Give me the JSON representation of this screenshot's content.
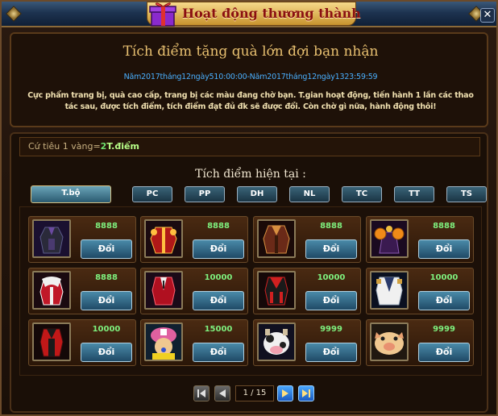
{
  "window": {
    "title": "Hoạt động thương thành",
    "close_label": "✕"
  },
  "banner": {
    "headline": "Tích điểm tặng quà lớn đợi bạn nhận",
    "date_range": "Năm2017tháng12ngày510:00:00-Năm2017tháng12ngày1323:59:59",
    "description": "Cực phẩm trang bị, quà cao cấp, trang bị các màu đang chờ bạn. T.gian hoạt động, tiến hành 1 lần các thao tác sau, được tích điểm, tích điểm đạt đủ đk sẽ được đổi. Còn chờ gì nữa, hành động thôi!"
  },
  "rate": {
    "prefix": "Cứ tiêu 1 vàng=",
    "value": "2",
    "unit": "T.điểm"
  },
  "points_label": "Tích điểm hiện tại :",
  "tabs": [
    {
      "label": "T.bộ",
      "active": true
    },
    {
      "label": "PC",
      "active": false
    },
    {
      "label": "PP",
      "active": false
    },
    {
      "label": "DH",
      "active": false
    },
    {
      "label": "NL",
      "active": false
    },
    {
      "label": "TC",
      "active": false
    },
    {
      "label": "TT",
      "active": false
    },
    {
      "label": "TS",
      "active": false
    }
  ],
  "items": [
    {
      "icon": "dark-armor-icon",
      "price": "8888",
      "button": "Đổi"
    },
    {
      "icon": "red-gold-coat-icon",
      "price": "8888",
      "button": "Đổi"
    },
    {
      "icon": "brown-coat-icon",
      "price": "8888",
      "button": "Đổi"
    },
    {
      "icon": "pumpkin-costume-icon",
      "price": "8888",
      "button": "Đổi"
    },
    {
      "icon": "fur-red-coat-icon",
      "price": "8888",
      "button": "Đổi"
    },
    {
      "icon": "red-suit-icon",
      "price": "10000",
      "button": "Đổi"
    },
    {
      "icon": "black-red-coat-icon",
      "price": "10000",
      "button": "Đổi"
    },
    {
      "icon": "marine-coat-icon",
      "price": "10000",
      "button": "Đổi"
    },
    {
      "icon": "red-black-jacket-icon",
      "price": "10000",
      "button": "Đổi"
    },
    {
      "icon": "chopper-pet-icon",
      "price": "15000",
      "button": "Đổi"
    },
    {
      "icon": "cow-pet-icon",
      "price": "9999",
      "button": "Đổi"
    },
    {
      "icon": "pig-pet-icon",
      "price": "9999",
      "button": "Đổi"
    }
  ],
  "pager": {
    "info": "1 / 15"
  },
  "colors": {
    "price": "#7ef07e",
    "link_blue": "#4ab0ff",
    "title_red": "#8a1010",
    "headline_gold": "#e8c070"
  }
}
